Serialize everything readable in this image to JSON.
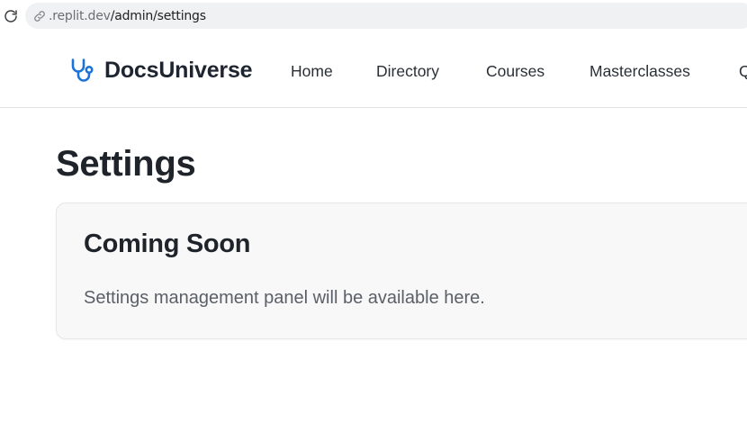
{
  "browser": {
    "url_domain": ".replit.dev",
    "url_path": "/admin/settings",
    "icons": {
      "reload": "reload-icon",
      "link": "link-icon"
    }
  },
  "header": {
    "brand_name": "DocsUniverse",
    "brand_icon": "stethoscope-icon",
    "brand_color": "#1a73d9",
    "nav": [
      {
        "label": "Home"
      },
      {
        "label": "Directory"
      },
      {
        "label": "Courses"
      },
      {
        "label": "Masterclasses"
      },
      {
        "label": "Q"
      }
    ]
  },
  "main": {
    "title": "Settings",
    "card": {
      "title": "Coming Soon",
      "text": "Settings management panel will be available here."
    }
  }
}
